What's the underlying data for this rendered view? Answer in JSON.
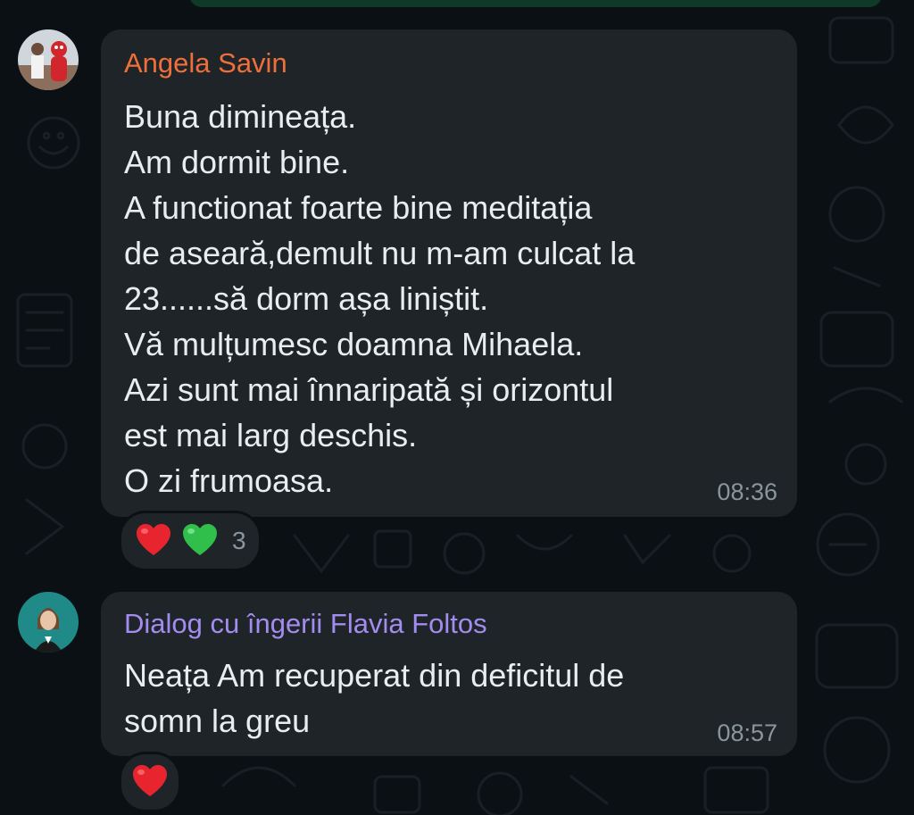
{
  "messages": [
    {
      "sender": "Angela Savin",
      "sender_color": "#ef6f3a",
      "text": "Buna dimineața.\nAm dormit bine.\nA functionat foarte bine meditația\nde aseară,demult nu m-am culcat la\n23......să dorm așa liniștit.\nVă mulțumesc doamna Mihaela.\nAzi sunt mai înnaripată și orizontul\nest mai  larg deschis.\nO zi frumoasa.",
      "time": "08:36",
      "reactions": {
        "emojis": [
          "red-heart",
          "green-heart"
        ],
        "count": "3"
      }
    },
    {
      "sender": "Dialog cu îngerii Flavia Foltos",
      "sender_color": "#a38cf0",
      "text": "Neața Am recuperat din deficitul de\nsomn la greu",
      "time": "08:57",
      "reactions": {
        "emojis": [
          "red-heart"
        ]
      }
    }
  ],
  "colors": {
    "background": "#0b1014",
    "bubble": "#1e2428",
    "message_text": "#e9edef",
    "meta_text": "#8a969e",
    "outgoing_bubble": "#0f3a29",
    "red_heart": "#e8252f",
    "green_heart": "#2fbf4a"
  }
}
